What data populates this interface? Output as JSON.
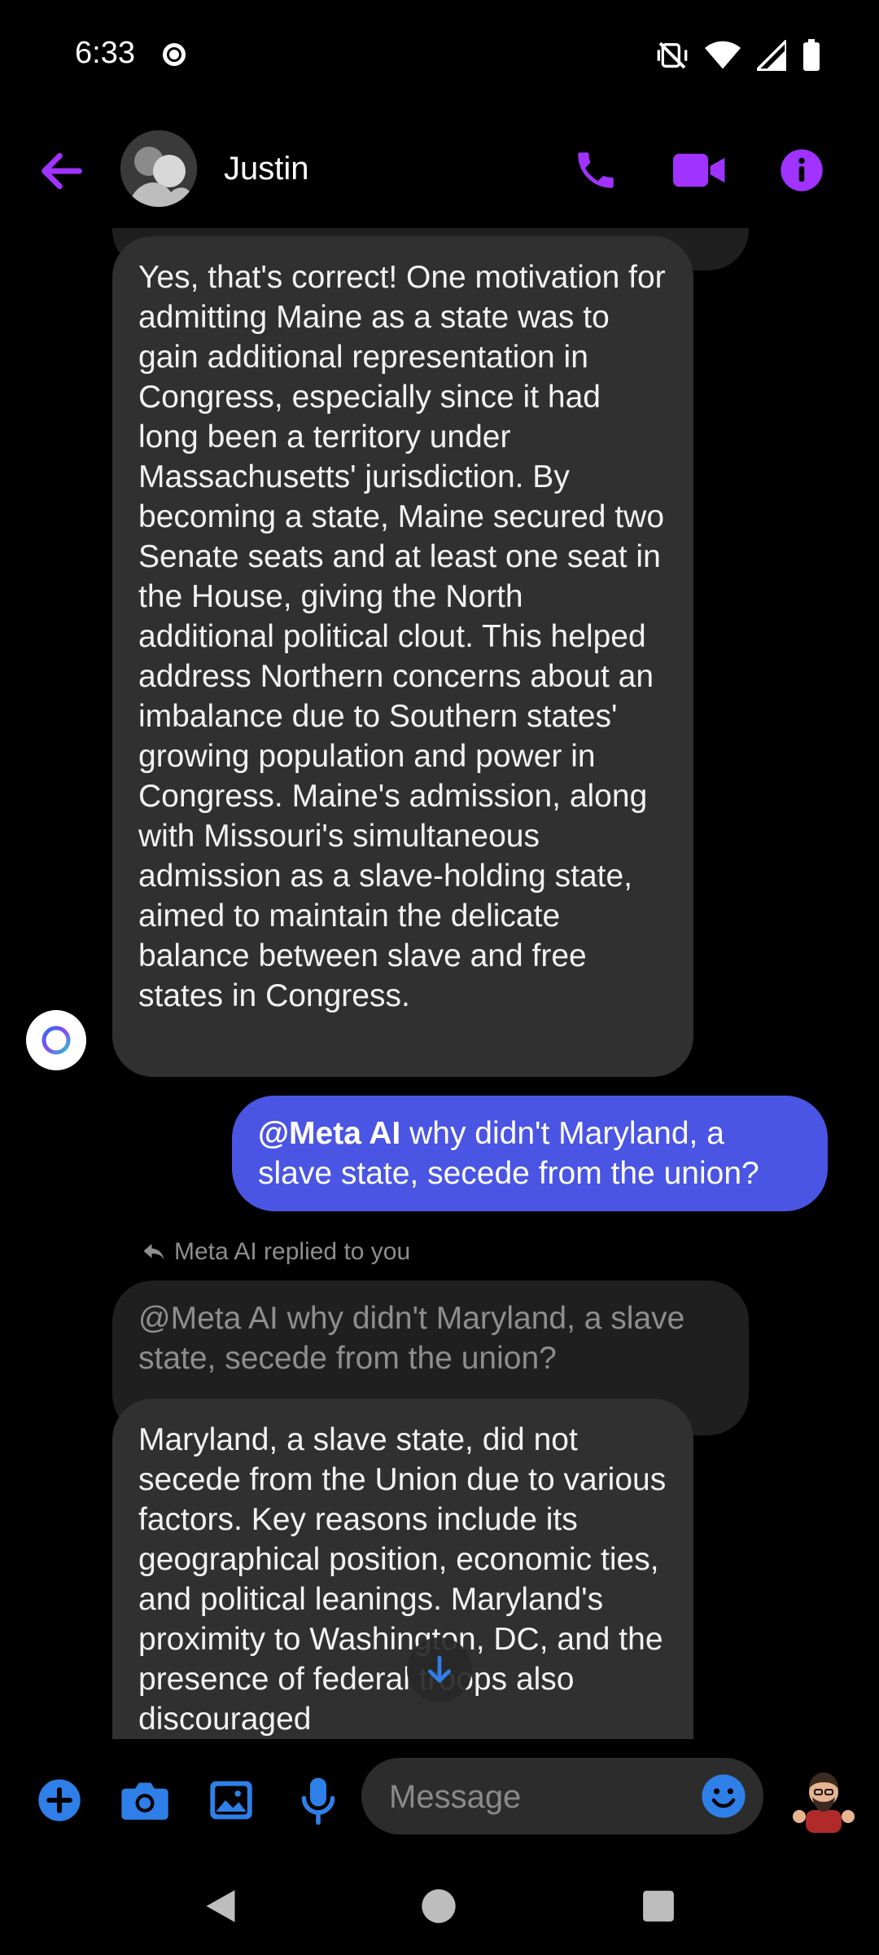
{
  "status_bar": {
    "time": "6:33"
  },
  "header": {
    "contact_name": "Justin"
  },
  "messages": {
    "ai_reply_1": "Yes, that's correct! One motivation for admitting Maine as a state was to gain additional representation in Congress, especially since it had long been a territory under Massachusetts' jurisdiction. By becoming a state, Maine secured two Senate seats and at least one seat in the House, giving the North additional political clout. This helped address Northern concerns about an imbalance due to Southern states' growing population and power in Congress. Maine's admission, along with Missouri's simultaneous admission as a slave-holding state, aimed to maintain the delicate balance between slave and free states in Congress.",
    "user_message": {
      "mention": "@Meta AI",
      "text": " why didn't Maryland, a slave state, secede from the union?"
    },
    "replied_label": "Meta AI replied to you",
    "quoted_text": "@Meta AI why didn't Maryland, a slave state, secede from the union?",
    "ai_reply_2": "Maryland, a slave state, did not secede from the Union due to various factors. Key reasons include its geographical position, economic ties, and political leanings. Maryland's proximity to Washington, DC, and the presence of federal troops also discouraged"
  },
  "composer": {
    "placeholder": "Message"
  },
  "colors": {
    "accent_purple": "#a033ff",
    "user_bubble": "#4a55e4",
    "ai_bubble": "#303030",
    "composer_blue": "#2f7fe8"
  },
  "icons": [
    "back-arrow-icon",
    "phone-icon",
    "video-icon",
    "info-icon",
    "plus-icon",
    "camera-icon",
    "gallery-icon",
    "mic-icon",
    "emoji-icon",
    "scroll-down-icon"
  ]
}
